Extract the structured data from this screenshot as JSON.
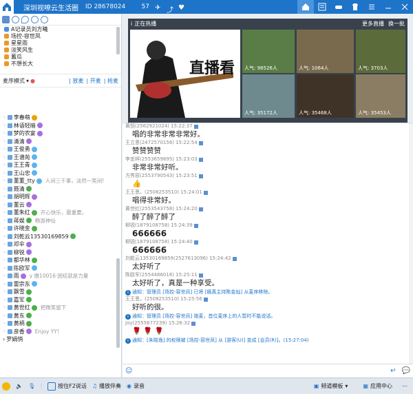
{
  "app": {
    "title": "深圳视嘹云生活圈",
    "id_label": "ID 28678024",
    "online_count": "57"
  },
  "channels": [
    {
      "label": "A记录员刘方曦",
      "color": "#4a90e2"
    },
    {
      "label": "场控-容世凤",
      "color": "#e89a2b"
    },
    {
      "label": "星星雨",
      "color": "#e89a2b"
    },
    {
      "label": "淡笑风生",
      "color": "#e89a2b"
    },
    {
      "label": "蓄瓜",
      "color": "#e89a2b"
    },
    {
      "label": "不想长大",
      "color": "#e89a2b"
    }
  ],
  "mode": {
    "label": "麦序模式",
    "buttons": [
      "| 放麦",
      "| 开麦",
      "| 抢麦"
    ]
  },
  "users": [
    {
      "name": "李春萌",
      "sig": "",
      "badge": "#e8a300"
    },
    {
      "name": "林语轻暗",
      "sig": "",
      "badge": "#a670e0"
    },
    {
      "name": "梦的农宴",
      "sig": "",
      "badge": "#a670e0"
    },
    {
      "name": "清清",
      "sig": "",
      "badge": "#a670e0"
    },
    {
      "name": "王俊勇",
      "sig": "",
      "badge": "#5fb2f0"
    },
    {
      "name": "王谱苑",
      "sig": "",
      "badge": "#5fb2f0"
    },
    {
      "name": "王王青",
      "sig": "",
      "badge": "#5fb2f0"
    },
    {
      "name": "王山忠",
      "sig": "",
      "badge": "#5fb2f0"
    },
    {
      "name": "董董_tty",
      "sig": "人间三千事，淡然一笑间!",
      "badge": "#5fb2f0"
    },
    {
      "name": "聂清",
      "sig": "",
      "badge": "#4cae4c"
    },
    {
      "name": "胡明辉",
      "sig": "",
      "badge": "#a670e0"
    },
    {
      "name": "董云",
      "sig": "",
      "badge": "#a670e0"
    },
    {
      "name": "董朱红",
      "sig": "开心快乐，最重要。",
      "badge": "#4cae4c"
    },
    {
      "name": "蒋娱",
      "sig": "畅游神仙",
      "badge": "#4cae4c"
    },
    {
      "name": "许晓金",
      "sig": "",
      "badge": "#4cae4c"
    },
    {
      "name": "刘乾云13530169859",
      "sig": "",
      "badge": "#4cae4c"
    },
    {
      "name": "邓伞",
      "sig": "",
      "badge": "#a670e0"
    },
    {
      "name": "柳锐",
      "sig": "",
      "badge": "#a670e0"
    },
    {
      "name": "都华林",
      "sig": "",
      "badge": "#4cae4c"
    },
    {
      "name": "陈欧军",
      "sig": "",
      "badge": "#5fb2f0"
    },
    {
      "name": "雨",
      "sig": "y 缴10016·团结就是力量",
      "badge": "#a670e0"
    },
    {
      "name": "雷宗东",
      "sig": "",
      "badge": "#5fb2f0"
    },
    {
      "name": "飘雪",
      "sig": "",
      "badge": "#4cae4c"
    },
    {
      "name": "嘉军",
      "sig": "",
      "badge": "#4cae4c"
    },
    {
      "name": "黄世红",
      "sig": "把微笑留下",
      "badge": "#4cae4c"
    },
    {
      "name": "黄东",
      "sig": "",
      "badge": "#4cae4c"
    },
    {
      "name": "黄柄",
      "sig": "",
      "badge": "#4cae4c"
    },
    {
      "name": "彦香",
      "sig": "Enjoy YY!",
      "badge": "#a670e0"
    }
  ],
  "users_footer": "罗娟悄",
  "hot": {
    "title": "正在热播",
    "more": "更多直播",
    "switch": "换一批",
    "feature_text": "直播看",
    "thumbs": [
      {
        "pop": "人气: 98526人"
      },
      {
        "pop": "人气: 106⁢4人"
      },
      {
        "pop": "人气: 3703人"
      },
      {
        "pop": "人气: 35172人"
      },
      {
        "pop": "人气: 35468人"
      },
      {
        "pop": "人气: 35453人"
      }
    ]
  },
  "chat": [
    {
      "type": "head",
      "text": "黄恺(2562921024) 15:22:37"
    },
    {
      "type": "body",
      "text": "唱的非常非常非常好。"
    },
    {
      "type": "head",
      "text": "王立恩(2472570156) 15:22:54"
    },
    {
      "type": "body",
      "text": "赞赞赞赞"
    },
    {
      "type": "head",
      "text": "李忠祥(2553659895) 15:23:03"
    },
    {
      "type": "body",
      "text": "非常非常好听。"
    },
    {
      "type": "head",
      "text": "方秀容(2553790543) 15:23:51"
    },
    {
      "type": "body",
      "text": "👍"
    },
    {
      "type": "head",
      "text": "王王恩。(2508253510) 15:24:01"
    },
    {
      "type": "body",
      "text": "唱得非常好。"
    },
    {
      "type": "head",
      "text": "黄世红(2553543758) 15:24:20"
    },
    {
      "type": "body",
      "text": "醉了醉了醉了"
    },
    {
      "type": "head",
      "text": "柳锐(1879108758) 15:24:39"
    },
    {
      "type": "big",
      "text": "666666"
    },
    {
      "type": "head",
      "text": "柳锐(1879108758) 15:24:40"
    },
    {
      "type": "big",
      "text": "666666"
    },
    {
      "type": "head",
      "text": "刘乾云13530169859(2527613096) 15:24:42"
    },
    {
      "type": "body",
      "text": "太好听了"
    },
    {
      "type": "head",
      "text": "陈欧军(2554486016) 15:25:11"
    },
    {
      "type": "body",
      "text": "太好听了，真是一种享受。"
    },
    {
      "type": "sys",
      "text": "通知：管理员 [场控-容世凤] 已将 [瘾真主持陈金灿] 从麦序移除。"
    },
    {
      "type": "head",
      "text": "王王恩。(2508253510) 15:25:56"
    },
    {
      "type": "body",
      "text": "好听的很。"
    },
    {
      "type": "sys",
      "text": "通知：管理员 [场控-容世凤] 按麦，首位麦序上的人暂时不能说话。"
    },
    {
      "type": "head",
      "text": "Joy(2555677239) 15:26:32"
    },
    {
      "type": "body",
      "text": "🌹 🌹 🌹"
    },
    {
      "type": "sys",
      "text": "通知：[朱晓逸] 的权限被 [场控-容世凤] 从 [游客(U)] 变成 [会员(R)]。(15:27:04)"
    }
  ],
  "bottom": {
    "speak": "按住F2说话",
    "music": "播放伴奏",
    "record": "录音",
    "template": "频道模板",
    "apps": "应用中心"
  },
  "colors": {
    "primary": "#1e74c8",
    "dark_panel": "#39424c"
  }
}
